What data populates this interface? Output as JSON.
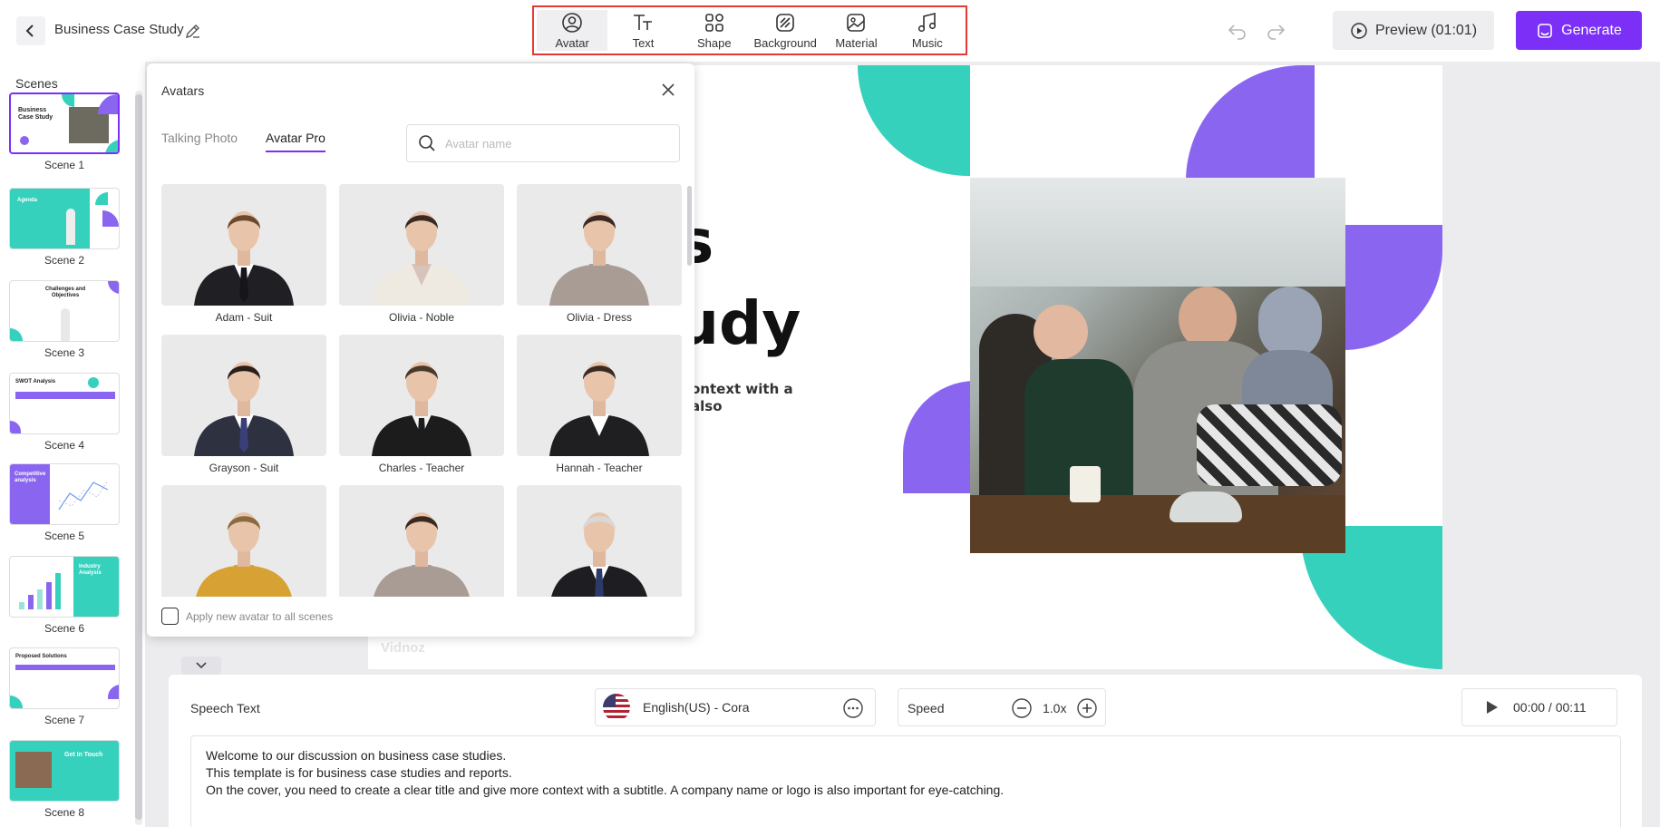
{
  "header": {
    "project_title": "Business Case Study",
    "toolbar": [
      {
        "label": "Avatar",
        "icon": "avatar-icon",
        "active": true
      },
      {
        "label": "Text",
        "icon": "text-icon",
        "active": false
      },
      {
        "label": "Shape",
        "icon": "shape-icon",
        "active": false
      },
      {
        "label": "Background",
        "icon": "background-icon",
        "active": false
      },
      {
        "label": "Material",
        "icon": "material-icon",
        "active": false
      },
      {
        "label": "Music",
        "icon": "music-icon",
        "active": false
      }
    ],
    "preview_label": "Preview (01:01)",
    "generate_label": "Generate"
  },
  "scenes": {
    "label": "Scenes",
    "items": [
      {
        "label": "Scene 1",
        "selected": true,
        "thumb_title": "Business Case Study"
      },
      {
        "label": "Scene 2",
        "selected": false,
        "thumb_title": "Agenda"
      },
      {
        "label": "Scene 3",
        "selected": false,
        "thumb_title": "Challenges and Objectives"
      },
      {
        "label": "Scene 4",
        "selected": false,
        "thumb_title": "SWOT Analysis"
      },
      {
        "label": "Scene 5",
        "selected": false,
        "thumb_title": "Competitive analysis"
      },
      {
        "label": "Scene 6",
        "selected": false,
        "thumb_title": "Industry Analysis"
      },
      {
        "label": "Scene 7",
        "selected": false,
        "thumb_title": "Proposed Solutions"
      },
      {
        "label": "Scene 8",
        "selected": false,
        "thumb_title": "Get In Touch"
      }
    ]
  },
  "canvas": {
    "title_line1_fragment": "s",
    "title_line2_fragment": "udy",
    "body_line1": "ontext with a",
    "body_line2": "also",
    "watermark": "Vidnoz"
  },
  "avatars_panel": {
    "title": "Avatars",
    "tabs": [
      {
        "label": "Talking Photo",
        "active": false
      },
      {
        "label": "Avatar Pro",
        "active": true
      }
    ],
    "search_placeholder": "Avatar name",
    "avatars": [
      {
        "name": "Adam - Suit",
        "outfit": "#1f1f24",
        "shirt": "#ffffff",
        "hair": "#6b4a2e",
        "tie": "#16161a"
      },
      {
        "name": "Olivia - Noble",
        "outfit": "#eeeae2",
        "shirt": "#d8c2bc",
        "hair": "#3a2a22",
        "tie": ""
      },
      {
        "name": "Olivia - Dress",
        "outfit": "#a89c94",
        "shirt": "#a89c94",
        "hair": "#3a2a22",
        "tie": ""
      },
      {
        "name": "Grayson - Suit",
        "outfit": "#2e3140",
        "shirt": "#ffffff",
        "hair": "#2a1e18",
        "tie": "#3a3f7a"
      },
      {
        "name": "Charles - Teacher",
        "outfit": "#1c1c1c",
        "shirt": "#f2f2f2",
        "hair": "#4a3a2c",
        "tie": "#1c1c1c"
      },
      {
        "name": "Hannah - Teacher",
        "outfit": "#1f1f22",
        "shirt": "#ffffff",
        "hair": "#3a2a20",
        "tie": ""
      },
      {
        "name": "",
        "outfit": "#d7a233",
        "shirt": "#d7a233",
        "hair": "#8a6a3e",
        "tie": ""
      },
      {
        "name": "",
        "outfit": "#a89c94",
        "shirt": "#a89c94",
        "hair": "#3a2a22",
        "tie": ""
      },
      {
        "name": "",
        "outfit": "#1e1e22",
        "shirt": "#ffffff",
        "hair": "#d8d8d8",
        "tie": "#2c3a6a"
      }
    ],
    "apply_label": "Apply new avatar to all scenes"
  },
  "speech": {
    "label": "Speech Text",
    "voice": "English(US) - Cora",
    "speed_label": "Speed",
    "speed_value": "1.0x",
    "time": "00:00 / 00:11",
    "lines": [
      "Welcome to our discussion on business case studies.",
      "This template is for business case studies and reports.",
      "On the cover, you need to create a clear title and give more context with a subtitle. A company name or logo is also important for eye-catching."
    ]
  },
  "colors": {
    "accent": "#7b2ff7",
    "teal": "#36d1bd",
    "purple_shape": "#8a66f0",
    "highlight_border": "#e53935"
  }
}
